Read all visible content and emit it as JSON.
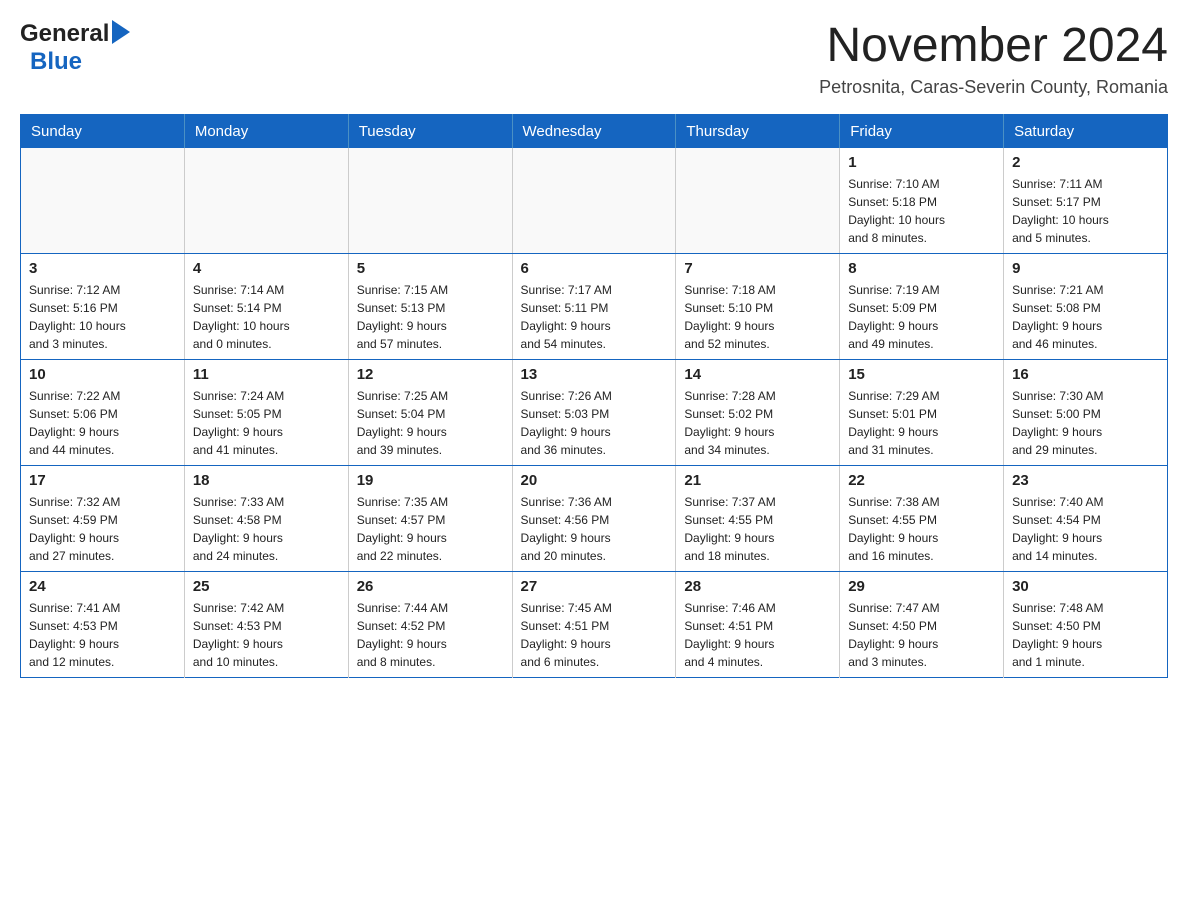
{
  "header": {
    "logo_general": "General",
    "logo_blue": "Blue",
    "month_title": "November 2024",
    "location": "Petrosnita, Caras-Severin County, Romania"
  },
  "weekdays": [
    "Sunday",
    "Monday",
    "Tuesday",
    "Wednesday",
    "Thursday",
    "Friday",
    "Saturday"
  ],
  "weeks": [
    {
      "days": [
        {
          "num": "",
          "info": ""
        },
        {
          "num": "",
          "info": ""
        },
        {
          "num": "",
          "info": ""
        },
        {
          "num": "",
          "info": ""
        },
        {
          "num": "",
          "info": ""
        },
        {
          "num": "1",
          "info": "Sunrise: 7:10 AM\nSunset: 5:18 PM\nDaylight: 10 hours\nand 8 minutes."
        },
        {
          "num": "2",
          "info": "Sunrise: 7:11 AM\nSunset: 5:17 PM\nDaylight: 10 hours\nand 5 minutes."
        }
      ]
    },
    {
      "days": [
        {
          "num": "3",
          "info": "Sunrise: 7:12 AM\nSunset: 5:16 PM\nDaylight: 10 hours\nand 3 minutes."
        },
        {
          "num": "4",
          "info": "Sunrise: 7:14 AM\nSunset: 5:14 PM\nDaylight: 10 hours\nand 0 minutes."
        },
        {
          "num": "5",
          "info": "Sunrise: 7:15 AM\nSunset: 5:13 PM\nDaylight: 9 hours\nand 57 minutes."
        },
        {
          "num": "6",
          "info": "Sunrise: 7:17 AM\nSunset: 5:11 PM\nDaylight: 9 hours\nand 54 minutes."
        },
        {
          "num": "7",
          "info": "Sunrise: 7:18 AM\nSunset: 5:10 PM\nDaylight: 9 hours\nand 52 minutes."
        },
        {
          "num": "8",
          "info": "Sunrise: 7:19 AM\nSunset: 5:09 PM\nDaylight: 9 hours\nand 49 minutes."
        },
        {
          "num": "9",
          "info": "Sunrise: 7:21 AM\nSunset: 5:08 PM\nDaylight: 9 hours\nand 46 minutes."
        }
      ]
    },
    {
      "days": [
        {
          "num": "10",
          "info": "Sunrise: 7:22 AM\nSunset: 5:06 PM\nDaylight: 9 hours\nand 44 minutes."
        },
        {
          "num": "11",
          "info": "Sunrise: 7:24 AM\nSunset: 5:05 PM\nDaylight: 9 hours\nand 41 minutes."
        },
        {
          "num": "12",
          "info": "Sunrise: 7:25 AM\nSunset: 5:04 PM\nDaylight: 9 hours\nand 39 minutes."
        },
        {
          "num": "13",
          "info": "Sunrise: 7:26 AM\nSunset: 5:03 PM\nDaylight: 9 hours\nand 36 minutes."
        },
        {
          "num": "14",
          "info": "Sunrise: 7:28 AM\nSunset: 5:02 PM\nDaylight: 9 hours\nand 34 minutes."
        },
        {
          "num": "15",
          "info": "Sunrise: 7:29 AM\nSunset: 5:01 PM\nDaylight: 9 hours\nand 31 minutes."
        },
        {
          "num": "16",
          "info": "Sunrise: 7:30 AM\nSunset: 5:00 PM\nDaylight: 9 hours\nand 29 minutes."
        }
      ]
    },
    {
      "days": [
        {
          "num": "17",
          "info": "Sunrise: 7:32 AM\nSunset: 4:59 PM\nDaylight: 9 hours\nand 27 minutes."
        },
        {
          "num": "18",
          "info": "Sunrise: 7:33 AM\nSunset: 4:58 PM\nDaylight: 9 hours\nand 24 minutes."
        },
        {
          "num": "19",
          "info": "Sunrise: 7:35 AM\nSunset: 4:57 PM\nDaylight: 9 hours\nand 22 minutes."
        },
        {
          "num": "20",
          "info": "Sunrise: 7:36 AM\nSunset: 4:56 PM\nDaylight: 9 hours\nand 20 minutes."
        },
        {
          "num": "21",
          "info": "Sunrise: 7:37 AM\nSunset: 4:55 PM\nDaylight: 9 hours\nand 18 minutes."
        },
        {
          "num": "22",
          "info": "Sunrise: 7:38 AM\nSunset: 4:55 PM\nDaylight: 9 hours\nand 16 minutes."
        },
        {
          "num": "23",
          "info": "Sunrise: 7:40 AM\nSunset: 4:54 PM\nDaylight: 9 hours\nand 14 minutes."
        }
      ]
    },
    {
      "days": [
        {
          "num": "24",
          "info": "Sunrise: 7:41 AM\nSunset: 4:53 PM\nDaylight: 9 hours\nand 12 minutes."
        },
        {
          "num": "25",
          "info": "Sunrise: 7:42 AM\nSunset: 4:53 PM\nDaylight: 9 hours\nand 10 minutes."
        },
        {
          "num": "26",
          "info": "Sunrise: 7:44 AM\nSunset: 4:52 PM\nDaylight: 9 hours\nand 8 minutes."
        },
        {
          "num": "27",
          "info": "Sunrise: 7:45 AM\nSunset: 4:51 PM\nDaylight: 9 hours\nand 6 minutes."
        },
        {
          "num": "28",
          "info": "Sunrise: 7:46 AM\nSunset: 4:51 PM\nDaylight: 9 hours\nand 4 minutes."
        },
        {
          "num": "29",
          "info": "Sunrise: 7:47 AM\nSunset: 4:50 PM\nDaylight: 9 hours\nand 3 minutes."
        },
        {
          "num": "30",
          "info": "Sunrise: 7:48 AM\nSunset: 4:50 PM\nDaylight: 9 hours\nand 1 minute."
        }
      ]
    }
  ]
}
